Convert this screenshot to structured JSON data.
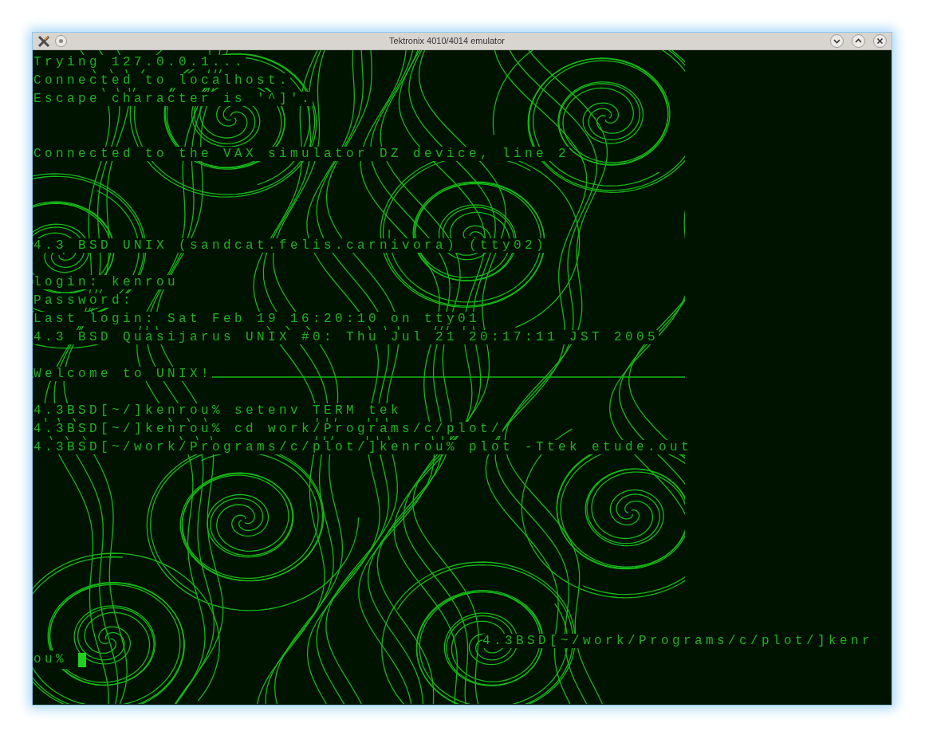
{
  "window": {
    "title": "Tektronix 4010/4014 emulator"
  },
  "terminal": {
    "blocks": [
      [
        "Trying 127.0.0.1...",
        "Connected to localhost.",
        "Escape character is '^]'."
      ],
      [
        "Connected to the VAX simulator DZ device, line 2"
      ],
      [
        "4.3 BSD UNIX (sandcat.felis.carnivora) (tty02)"
      ],
      [
        "login: kenrou",
        "Password:",
        "Last login: Sat Feb 19 16:20:10 on tty01",
        "4.3 BSD Quasijarus UNIX #0: Thu Jul 21 20:17:11 JST 2005"
      ],
      [
        "Welcome to UNIX!"
      ],
      [
        "4.3BSD[~/]kenrou% setenv TERM tek",
        "4.3BSD[~/]kenrou% cd work/Programs/c/plot/",
        "4.3BSD[~/work/Programs/c/plot/]kenrou% plot -Ttek etude.out"
      ]
    ],
    "prompt": {
      "line": "4.3BSD[~/work/Programs/c/plot/]kenr",
      "wrapped": "ou% "
    }
  }
}
